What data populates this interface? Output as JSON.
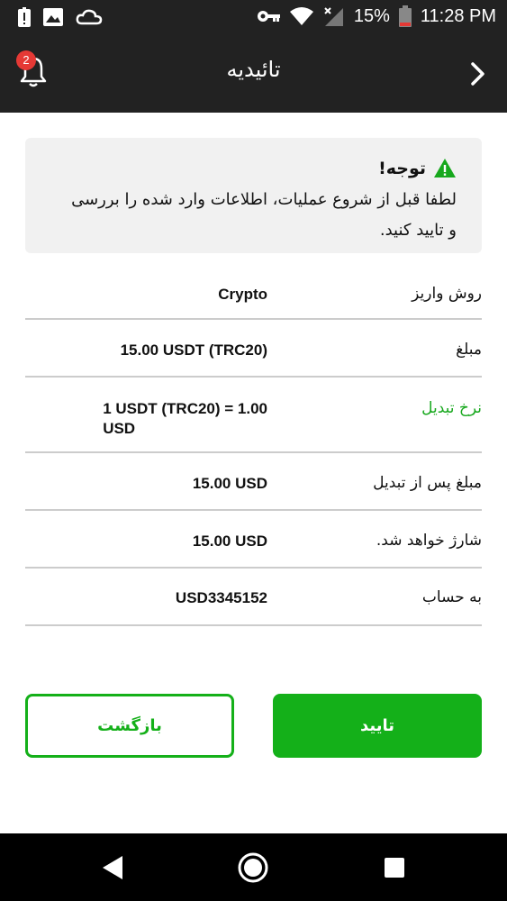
{
  "status_bar": {
    "battery_percent": "15%",
    "time": "11:28 PM"
  },
  "header": {
    "title": "تائیدیه",
    "notification_count": "2"
  },
  "notice": {
    "title": "توجه!",
    "body_line1": "لطفا قبل از شروع عملیات، اطلاعات وارد شده را بررسی",
    "body_line2": "و تایید کنید."
  },
  "details": [
    {
      "label": "روش واریز",
      "value": "Crypto"
    },
    {
      "label": "مبلغ",
      "value": "15.00 USDT (TRC20)"
    },
    {
      "label": "نرخ تبدیل",
      "value_line1": "1 USDT (TRC20) = 1.00",
      "value_line2": "USD"
    },
    {
      "label": "مبلغ پس از تبدیل",
      "value": "15.00 USD"
    },
    {
      "label": "شارژ خواهد شد.",
      "value": "15.00 USD"
    },
    {
      "label": "به حساب",
      "value": "USD3345152"
    }
  ],
  "buttons": {
    "back_label": "بازگشت",
    "confirm_label": "تایید"
  },
  "colors": {
    "accent_green": "#14b019",
    "bar_dark": "#222222",
    "badge_red": "#e53935"
  }
}
